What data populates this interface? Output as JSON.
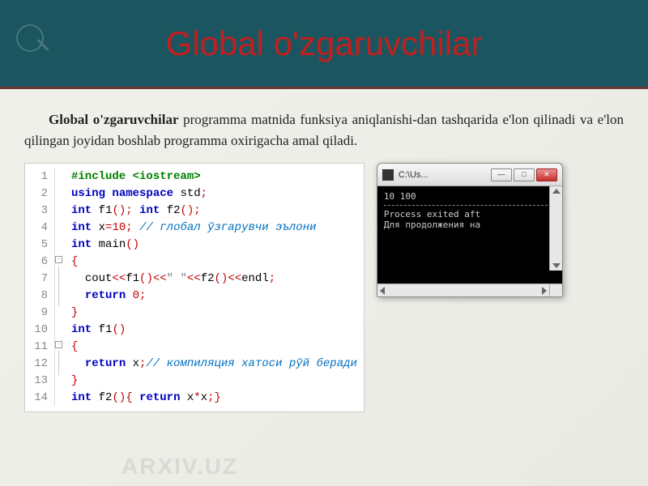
{
  "header": {
    "title": "Global o'zgaruvchilar"
  },
  "paragraph": {
    "bold": "Global o'zgaruvchilar",
    "rest": " programma matnida funksiya aniqlanishi-dan tashqarida e'lon qilinadi va e'lon qilingan joyidan boshlab programma oxirigacha amal qiladi."
  },
  "code": {
    "lines": [
      {
        "n": 1,
        "html": "<span class='pp'>#include &lt;iostream&gt;</span>"
      },
      {
        "n": 2,
        "html": "<span class='kw'>using</span> <span class='kw'>namespace</span> <span class='id'>std</span><span class='op'>;</span>"
      },
      {
        "n": 3,
        "html": "<span class='kw'>int</span> <span class='id'>f1</span><span class='op'>();</span> <span class='kw'>int</span> <span class='id'>f2</span><span class='op'>();</span>"
      },
      {
        "n": 4,
        "html": "<span class='kw'>int</span> <span class='id'>x</span><span class='op'>=</span><span class='num'>10</span><span class='op'>;</span> <span class='cm'>// глобал ўзгарувчи эълони</span>"
      },
      {
        "n": 5,
        "html": "<span class='kw'>int</span> <span class='id'>main</span><span class='op'>()</span>"
      },
      {
        "n": 6,
        "html": "<span class='op'>{</span>"
      },
      {
        "n": 7,
        "html": "  <span class='id'>cout</span><span class='op'>&lt;&lt;</span><span class='id'>f1</span><span class='op'>()&lt;&lt;</span><span class='str'>&quot; &quot;</span><span class='op'>&lt;&lt;</span><span class='id'>f2</span><span class='op'>()&lt;&lt;</span><span class='id'>endl</span><span class='op'>;</span>"
      },
      {
        "n": 8,
        "html": "  <span class='kw'>return</span> <span class='num'>0</span><span class='op'>;</span>"
      },
      {
        "n": 9,
        "html": "<span class='op'>}</span>"
      },
      {
        "n": 10,
        "html": "<span class='kw'>int</span> <span class='id'>f1</span><span class='op'>()</span>"
      },
      {
        "n": 11,
        "html": "<span class='op'>{</span>"
      },
      {
        "n": 12,
        "html": "  <span class='kw'>return</span> <span class='id'>x</span><span class='op'>;</span><span class='cm'>// компиляция хатоси рўй беради</span>"
      },
      {
        "n": 13,
        "html": "<span class='op'>}</span>"
      },
      {
        "n": 14,
        "html": "<span class='kw'>int</span> <span class='id'>f2</span><span class='op'>(){</span> <span class='kw'>return</span> <span class='id'>x</span><span class='op'>*</span><span class='id'>x</span><span class='op'>;}</span>"
      }
    ]
  },
  "console": {
    "title": "C:\\Us...",
    "output_line1": "10 100",
    "output_line2": "Process exited aft",
    "output_line3": "Для продолжения на"
  },
  "watermark": "ARXIV.UZ"
}
